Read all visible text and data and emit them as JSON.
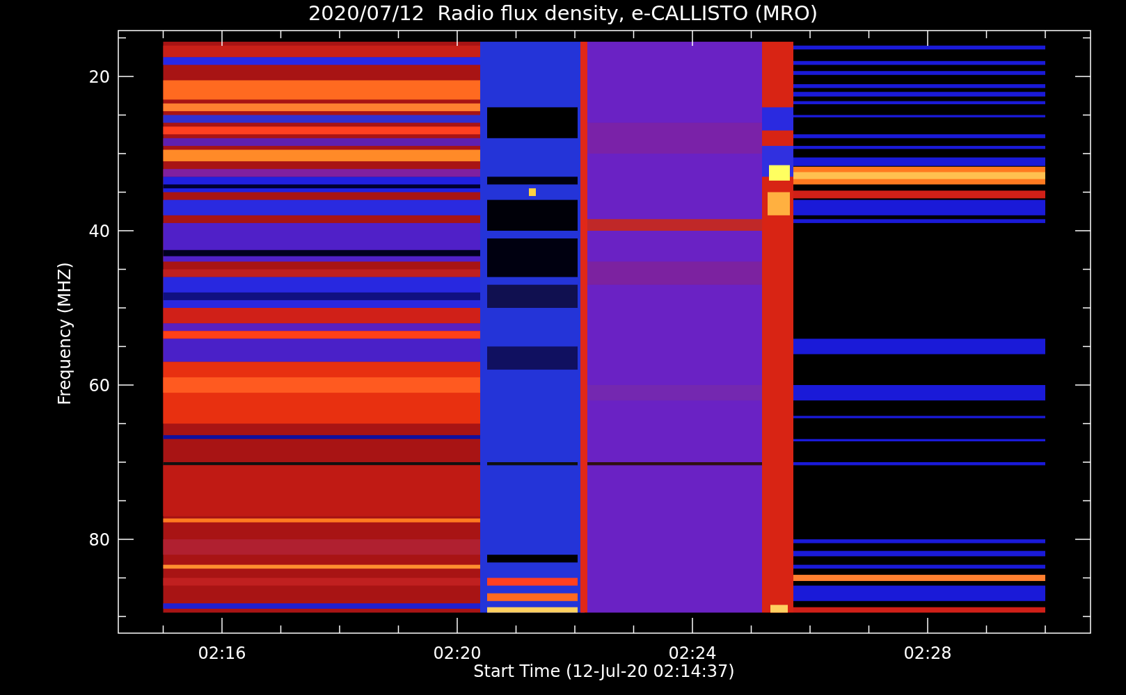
{
  "title": "2020/07/12  Radio flux density, e-CALLISTO (MRO)",
  "y_axis": {
    "label": "Frequency (MHZ)",
    "ticks": [
      "20",
      "40",
      "60",
      "80"
    ]
  },
  "x_axis": {
    "label": "Start Time (12-Jul-20 02:14:37)",
    "ticks": [
      "02:16",
      "02:20",
      "02:24",
      "02:28"
    ]
  }
}
